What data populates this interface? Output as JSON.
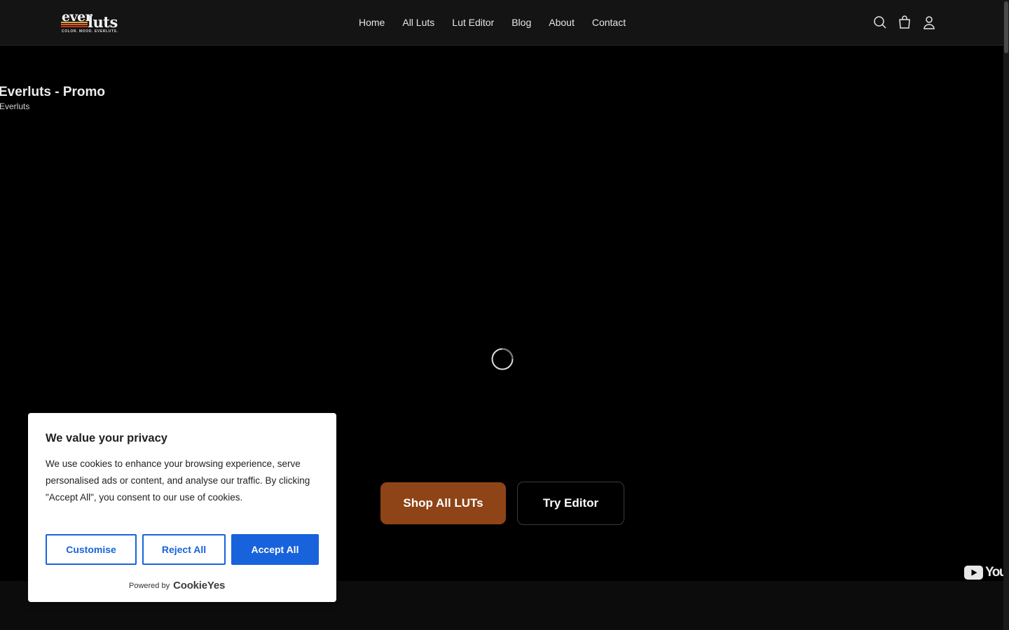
{
  "header": {
    "logo": {
      "word1": "ever",
      "word2": "luts",
      "tagline": "COLOR. MOOD. EVERLUTS.",
      "stripe_colors": [
        "#e9a13b",
        "#d9612b",
        "#b13a22",
        "#7a2a1c"
      ]
    },
    "nav": [
      {
        "label": "Home"
      },
      {
        "label": "All Luts"
      },
      {
        "label": "Lut Editor"
      },
      {
        "label": "Blog"
      },
      {
        "label": "About"
      },
      {
        "label": "Contact"
      }
    ],
    "icons": [
      "search-icon",
      "cart-icon",
      "account-icon"
    ]
  },
  "video": {
    "title": "Everluts - Promo",
    "channel": "Everluts",
    "youtube_label": "YouTube"
  },
  "cta": {
    "shop_label": "Shop All LUTs",
    "editor_label": "Try Editor"
  },
  "cookie": {
    "title": "We value your privacy",
    "body": "We use cookies to enhance your browsing experience, serve personalised ads or content, and analyse our traffic. By clicking \"Accept All\", you consent to our use of cookies.",
    "customise_label": "Customise",
    "reject_label": "Reject All",
    "accept_label": "Accept All",
    "powered_by": "Powered by",
    "brand": "CookieYes"
  },
  "colors": {
    "header_bg": "#141414",
    "cta_primary": "#8e4416",
    "cookie_accent": "#1863dc"
  }
}
